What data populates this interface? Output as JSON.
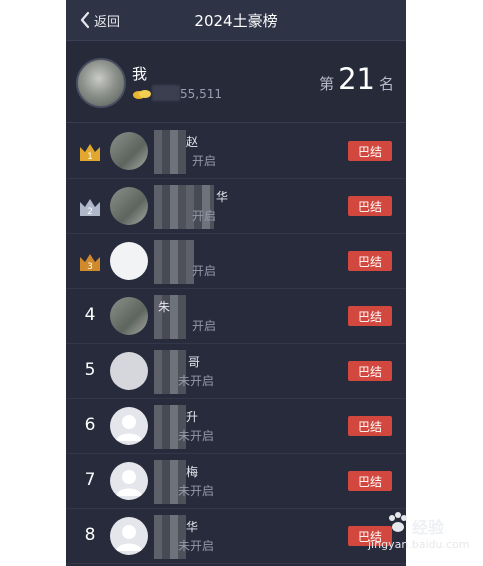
{
  "header": {
    "back_label": "返回",
    "title": "2024土豪榜"
  },
  "me": {
    "name": "我",
    "score_visible": "55,511",
    "rank_prefix": "第",
    "rank_number": "21",
    "rank_suffix": "名"
  },
  "rows": [
    {
      "rank": "1",
      "rank_icon": "gold-crown-icon",
      "name_visible": "赵",
      "status_visible": "开启",
      "button": "巴结"
    },
    {
      "rank": "2",
      "rank_icon": "silver-crown-icon",
      "name_visible": "华",
      "status_visible": "开启",
      "button": "巴结"
    },
    {
      "rank": "3",
      "rank_icon": "bronze-crown-icon",
      "name_visible": "",
      "status_visible": "开启",
      "button": "巴结"
    },
    {
      "rank": "4",
      "name_visible": "朱",
      "status_visible": "开启",
      "button": "巴结"
    },
    {
      "rank": "5",
      "name_visible": "哥",
      "status_visible": "未开启",
      "button": "巴结"
    },
    {
      "rank": "6",
      "name_visible": "升",
      "status_visible": "未开启",
      "button": "巴结"
    },
    {
      "rank": "7",
      "name_visible": "梅",
      "status_visible": "未开启",
      "button": "巴结"
    },
    {
      "rank": "8",
      "name_visible": "华",
      "status_visible": "未开启",
      "button": "巴结"
    }
  ],
  "watermark": {
    "brand": "经验",
    "url": "jingyan.baidu.com"
  },
  "colors": {
    "background": "#272b3b",
    "accent_button": "#d2483f",
    "gold": "#e2a72e",
    "silver": "#aeb8c9",
    "bronze": "#d08a2b"
  }
}
